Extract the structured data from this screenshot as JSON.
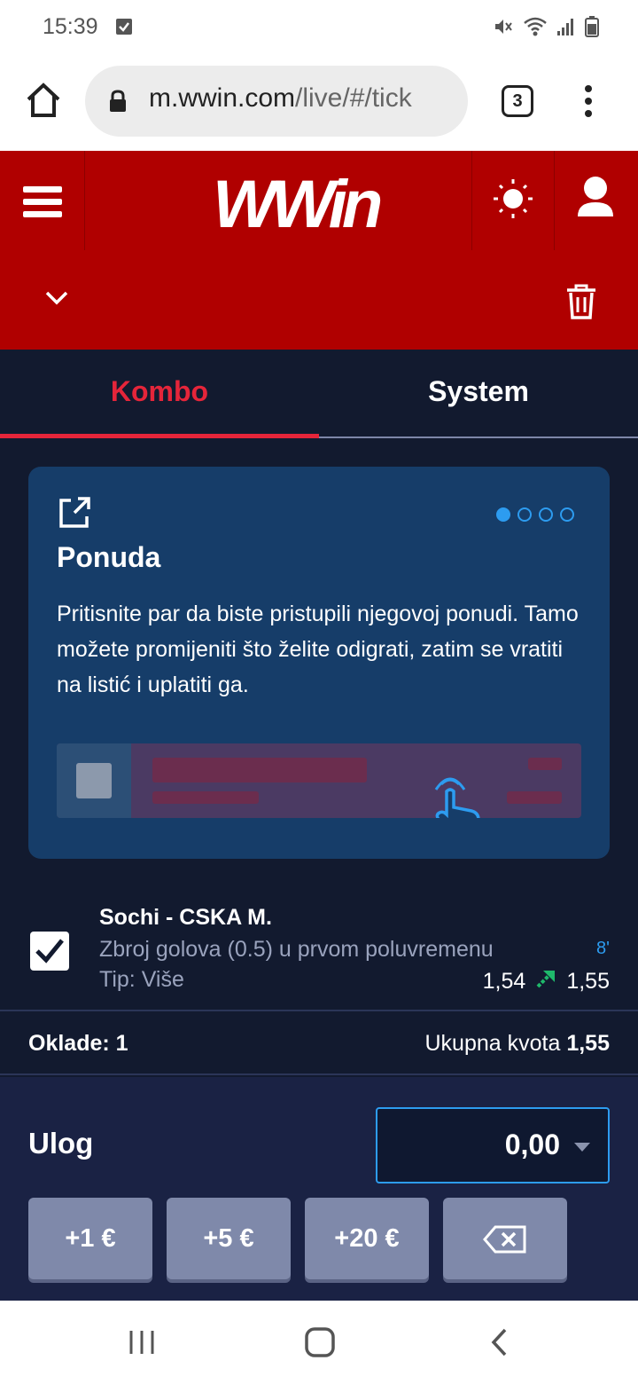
{
  "status_bar": {
    "time": "15:39"
  },
  "browser": {
    "url_host": "m.wwin.com",
    "url_path": "/live/#/tick",
    "tab_count": "3"
  },
  "header": {
    "logo_text": "WWin"
  },
  "tabs": [
    {
      "label": "Kombo",
      "active": true
    },
    {
      "label": "System",
      "active": false
    }
  ],
  "info_card": {
    "title": "Ponuda",
    "text": "Pritisnite par da biste pristupili njegovoj ponudi. Tamo možete promijeniti što želite odigrati, zatim se vratiti na listić i uplatiti ga.",
    "page_index": 1,
    "page_count": 4
  },
  "bet": {
    "match": "Sochi - CSKA M.",
    "market": "Zbroj golova (0.5) u prvom poluvremenu",
    "tip": "Tip: Više",
    "minute": "8'",
    "old_odds": "1,54",
    "new_odds": "1,55",
    "checked": true
  },
  "summary": {
    "bets_label": "Oklade: 1",
    "total_label": "Ukupna kvota",
    "total_value": "1,55"
  },
  "stake": {
    "label": "Ulog",
    "value": "0,00",
    "quick_buttons": [
      "+1 €",
      "+5 €",
      "+20 €"
    ]
  },
  "colors": {
    "brand_red": "#b00000",
    "accent_red": "#e5253a",
    "accent_blue": "#2d9cf0",
    "odds_up_green": "#1fb96b"
  }
}
